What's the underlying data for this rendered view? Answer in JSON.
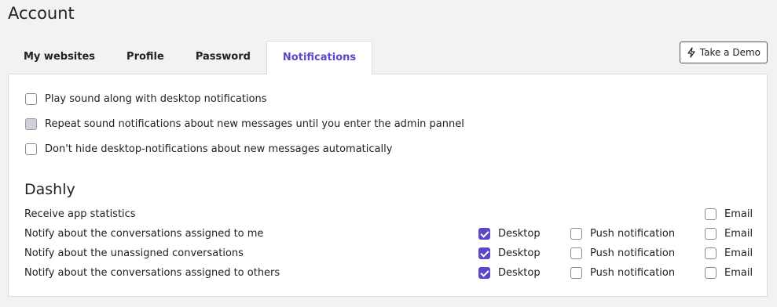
{
  "page": {
    "title": "Account"
  },
  "tabs": [
    {
      "label": "My websites",
      "active": false
    },
    {
      "label": "Profile",
      "active": false
    },
    {
      "label": "Password",
      "active": false
    },
    {
      "label": "Notifications",
      "active": true
    }
  ],
  "demo_button": {
    "label": "Take a Demo",
    "icon": "lightning-icon"
  },
  "general_options": [
    {
      "label": "Play sound along with desktop notifications",
      "checked": false
    },
    {
      "label": "Repeat sound notifications about new messages until you enter the admin pannel",
      "checked": false,
      "disabled_look": true
    },
    {
      "label": "Don't hide desktop-notifications about new messages automatically",
      "checked": false
    }
  ],
  "section": {
    "title": "Dashly"
  },
  "notification_rows": [
    {
      "label": "Receive app statistics",
      "email_label": "Email",
      "email": false
    },
    {
      "label": "Notify about the conversations assigned to me",
      "desktop_label": "Desktop",
      "desktop": true,
      "push_label": "Push notification",
      "push": false,
      "email_label": "Email",
      "email": false
    },
    {
      "label": "Notify about the unassigned conversations",
      "desktop_label": "Desktop",
      "desktop": true,
      "push_label": "Push notification",
      "push": false,
      "email_label": "Email",
      "email": false
    },
    {
      "label": "Notify about the conversations assigned to others",
      "desktop_label": "Desktop",
      "desktop": true,
      "push_label": "Push notification",
      "push": false,
      "email_label": "Email",
      "email": false
    }
  ],
  "colors": {
    "accent": "#5b47c9",
    "background": "#f2f2f2",
    "panel": "#ffffff"
  }
}
